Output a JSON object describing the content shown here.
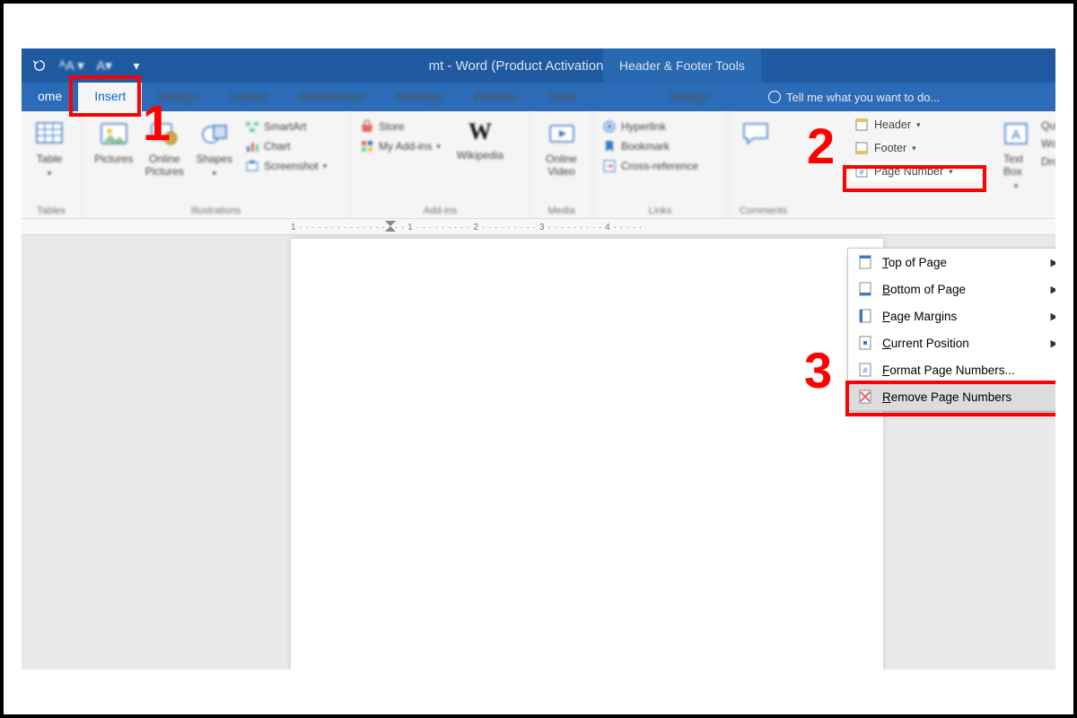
{
  "titlebar": {
    "undo": "↶",
    "title": "mt - Word (Product Activation Failed)",
    "context_tab": "Header & Footer Tools"
  },
  "tabs": {
    "home": "ome",
    "insert": "Insert",
    "design": "Design",
    "layout": "Layout",
    "references": "References",
    "mailings": "Mailings",
    "review": "Review",
    "view": "View",
    "context_design": "Design"
  },
  "tellme": "Tell me what you want to do...",
  "ribbon": {
    "tables": {
      "table": "Table",
      "group": "Tables"
    },
    "illustrations": {
      "pictures": "Pictures",
      "online_pictures": "Online Pictures",
      "shapes": "Shapes",
      "smartart": "SmartArt",
      "chart": "Chart",
      "screenshot": "Screenshot",
      "group": "Illustrations"
    },
    "addins": {
      "store": "Store",
      "myaddins": "My Add-ins",
      "wikipedia": "Wikipedia",
      "group": "Add-ins"
    },
    "media": {
      "online_video": "Online Video",
      "group": "Media"
    },
    "links": {
      "hyperlink": "Hyperlink",
      "bookmark": "Bookmark",
      "crossref": "Cross-reference",
      "group": "Links"
    },
    "comments": {
      "group": "Comments"
    },
    "headerfooter": {
      "header": "Header",
      "footer": "Footer",
      "page_number": "Page Number"
    },
    "text": {
      "textbox": "Text Box",
      "quick": "Quic",
      "word": "Wor",
      "drop": "Dro"
    }
  },
  "ruler": {
    "marks": "1 · · · · · · · · · · · · · · · · · 1 · · · · · · · · · 2 · · · · · · · · · 3 · · · · · · · · · 4 · · · · ·"
  },
  "menu": {
    "top_of_page": "Top of Page",
    "bottom_of_page": "Bottom of Page",
    "page_margins": "Page Margins",
    "current_position": "Current Position",
    "format": "Format Page Numbers...",
    "remove": "Remove Page Numbers"
  },
  "callouts": {
    "n1": "1",
    "n2": "2",
    "n3": "3"
  }
}
